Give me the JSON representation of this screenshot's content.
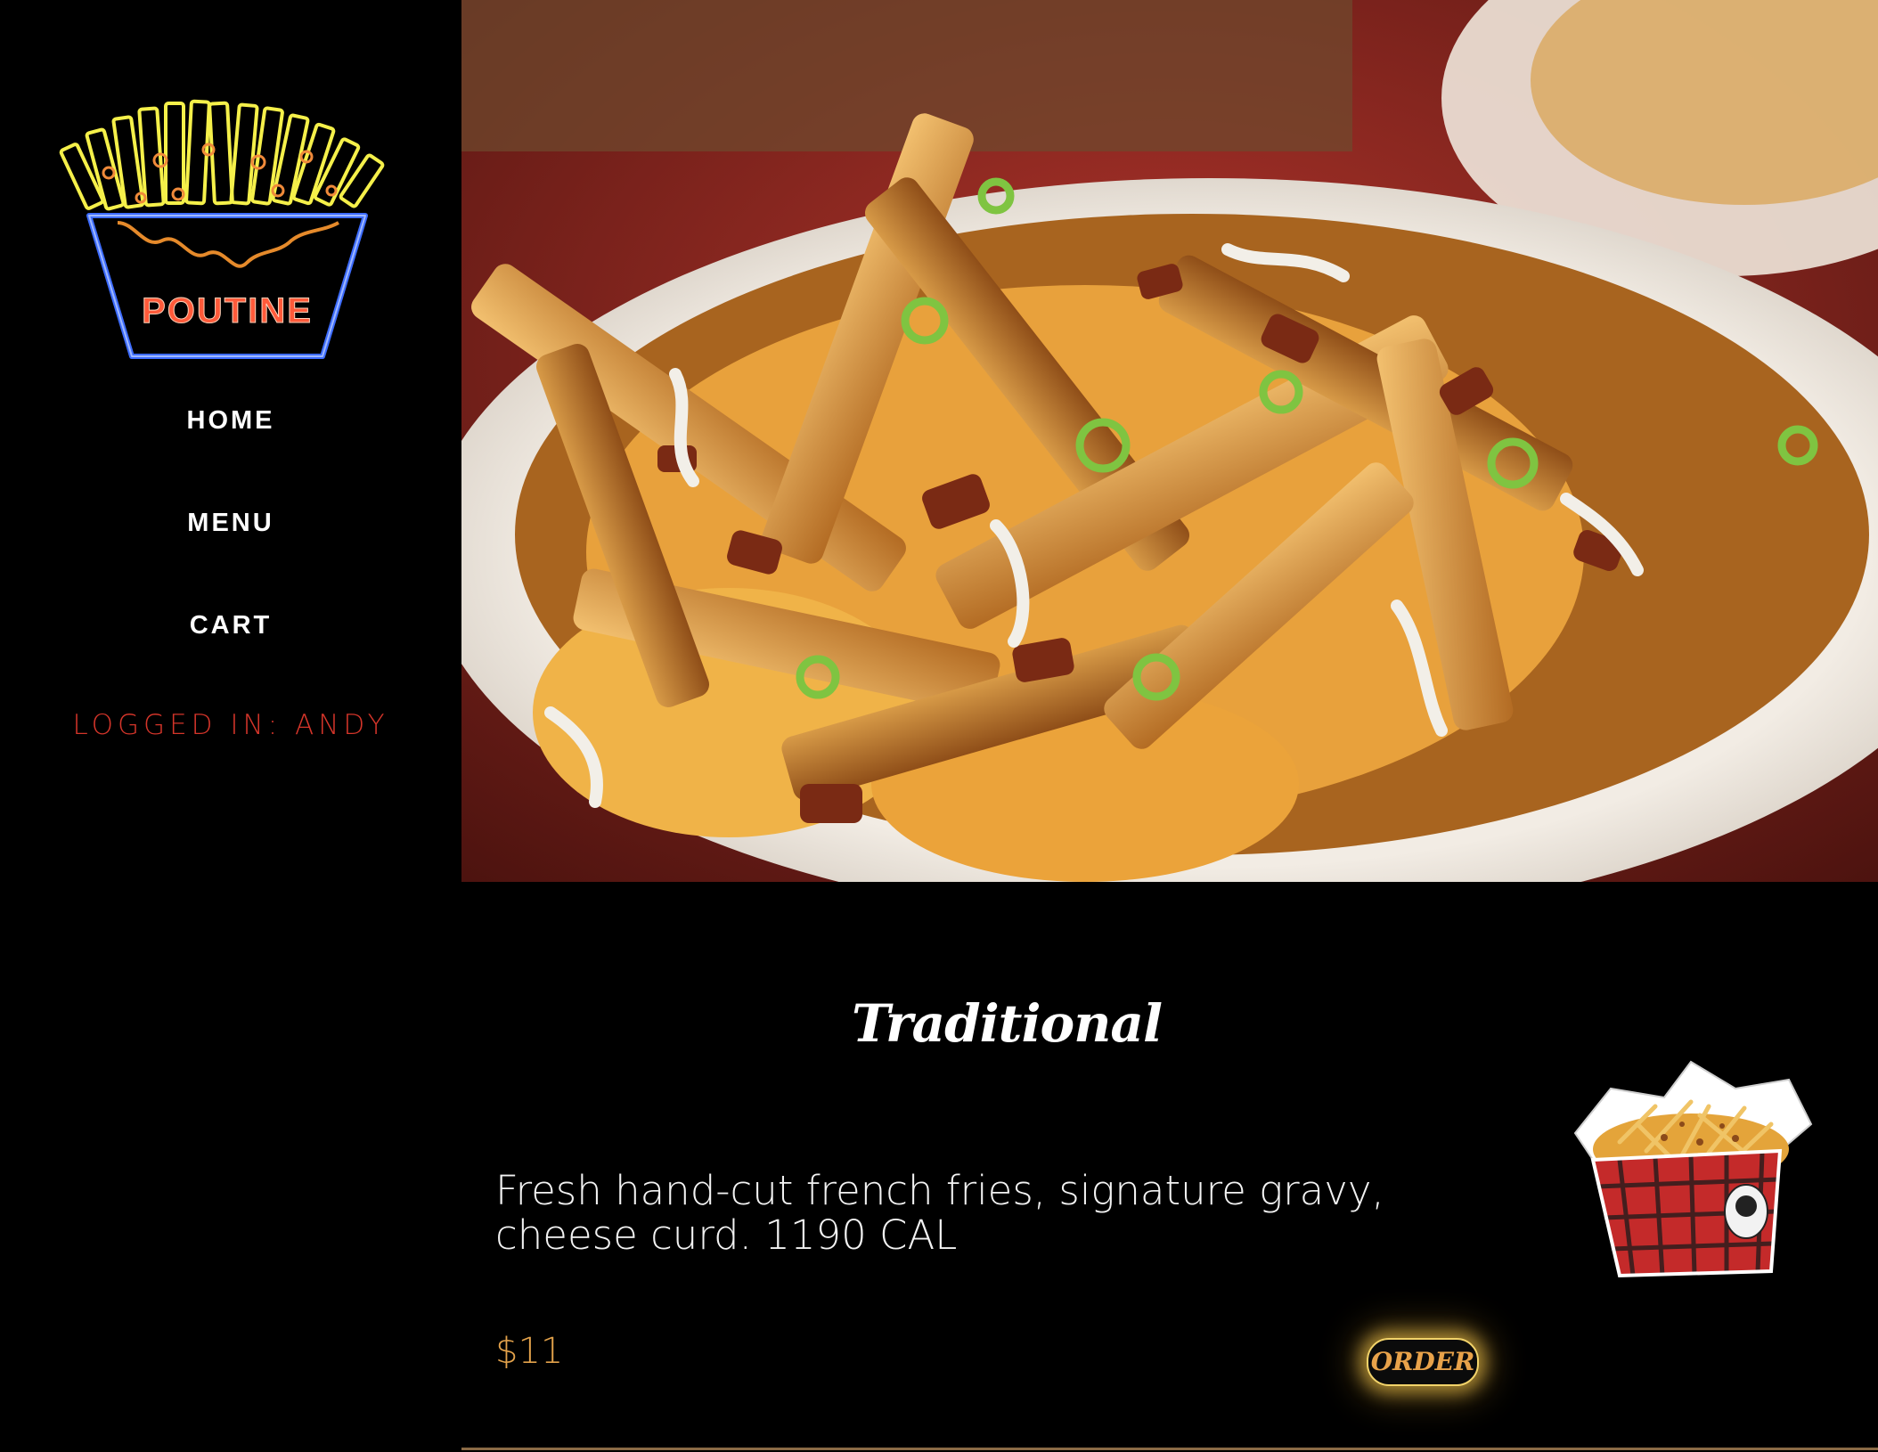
{
  "brand": {
    "logo_text": "POUTINE",
    "logo_icon": "neon-poutine-logo"
  },
  "nav": {
    "home": "HOME",
    "menu": "MENU",
    "cart": "CART"
  },
  "user": {
    "status": "LOGGED IN: ANDY"
  },
  "hero": {
    "image_icon": "poutine-photo"
  },
  "product": {
    "title": "Traditional",
    "description": "Fresh hand-cut french fries, signature gravy, cheese curd. 1190 CAL",
    "price": "$11",
    "order_label": "ORDER",
    "thumbnail_icon": "poutine-box-icon"
  },
  "colors": {
    "background": "#000000",
    "nav_text": "#ffffff",
    "login_text": "#d5352a",
    "price_text": "#e3a24b",
    "order_glow": "#f2d36a"
  }
}
